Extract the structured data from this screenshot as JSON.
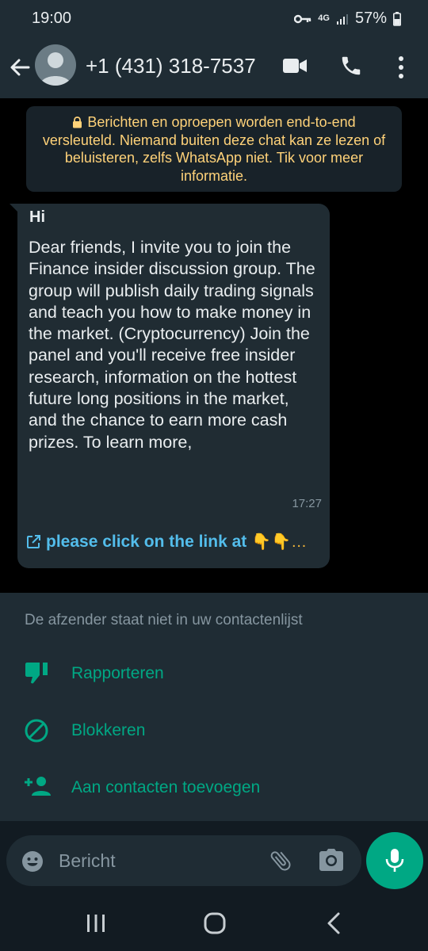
{
  "status": {
    "time": "19:00",
    "network": "4G",
    "battery": "57%"
  },
  "header": {
    "contact": "+1 (431) 318-7537"
  },
  "encryption_notice": "Berichten en oproepen worden end-to-end versleuteld. Niemand buiten deze chat kan ze lezen of beluisteren, zelfs WhatsApp niet. Tik voor meer informatie.",
  "message": {
    "title": "Hi",
    "body": "Dear friends, I invite you to join the Finance insider discussion group. The group will publish daily trading signals and teach you how to make money in the market. (Cryptocurrency) Join the panel and you'll receive free insider research, information on the hottest future long positions in the market, and the chance to earn more cash prizes. To learn more,",
    "time": "17:27",
    "link_text": "please click on the link at",
    "link_emoji": "👇👇…"
  },
  "unknown_sender": {
    "note": "De afzender staat niet in uw contactenlijst",
    "actions": [
      {
        "label": "Rapporteren",
        "icon": "thumbs-down-icon"
      },
      {
        "label": "Blokkeren",
        "icon": "block-icon"
      },
      {
        "label": "Aan contacten toevoegen",
        "icon": "add-person-icon"
      }
    ]
  },
  "composer": {
    "placeholder": "Bericht"
  },
  "colors": {
    "accent": "#00a884",
    "link": "#53bdeb",
    "notice_text": "#ffd279"
  }
}
